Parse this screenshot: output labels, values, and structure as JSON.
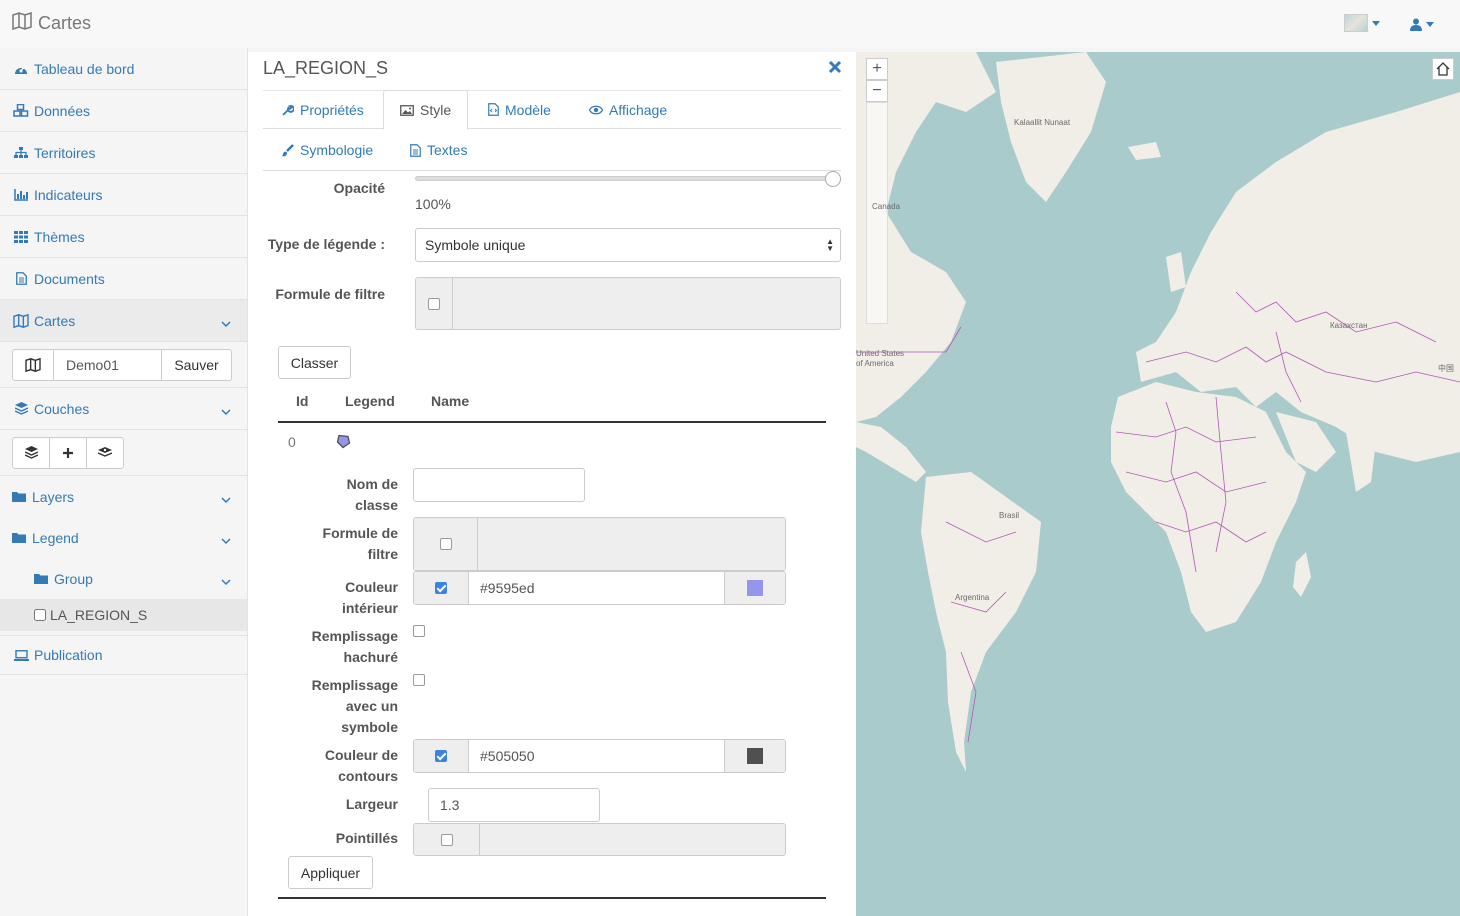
{
  "app": {
    "title": "Cartes"
  },
  "sidebar": {
    "items": [
      {
        "label": "Tableau de bord",
        "icon": "dashboard-icon"
      },
      {
        "label": "Données",
        "icon": "cubes-icon"
      },
      {
        "label": "Territoires",
        "icon": "sitemap-icon"
      },
      {
        "label": "Indicateurs",
        "icon": "bar-chart-icon"
      },
      {
        "label": "Thèmes",
        "icon": "grid-icon"
      },
      {
        "label": "Documents",
        "icon": "document-icon"
      },
      {
        "label": "Cartes",
        "icon": "map-icon"
      }
    ],
    "map_name": "Demo01",
    "save_label": "Sauver",
    "couches_label": "Couches",
    "layers_label": "Layers",
    "legend_label": "Legend",
    "group_label": "Group",
    "layer_item": "LA_REGION_S",
    "publication_label": "Publication"
  },
  "panel": {
    "title": "LA_REGION_S",
    "tabs": [
      "Propriétés",
      "Style",
      "Modèle",
      "Affichage"
    ],
    "active_tab": "Style",
    "subtabs": [
      "Symbologie",
      "Textes"
    ],
    "opacity_label": "Opacité",
    "opacity_value": "100%",
    "opacity_fraction": 1.0,
    "legend_type_label": "Type de légende :",
    "legend_type_value": "Symbole unique",
    "filter_label": "Formule de filtre",
    "classer_label": "Classer",
    "table_headers": [
      "Id",
      "Legend",
      "Name"
    ],
    "row_id": "0",
    "class_name_label_1": "Nom de",
    "class_name_label_2": "classe",
    "class_filter_label_1": "Formule de",
    "class_filter_label_2": "filtre",
    "fill_color_label_1": "Couleur",
    "fill_color_label_2": "intérieur",
    "fill_color_value": "#9595ed",
    "hatch_label_1": "Remplissage",
    "hatch_label_2": "hachuré",
    "symbol_fill_label_1": "Remplissage",
    "symbol_fill_label_2": "avec un",
    "symbol_fill_label_3": "symbole",
    "stroke_color_label_1": "Couleur de",
    "stroke_color_label_2": "contours",
    "stroke_color_value": "#505050",
    "width_label": "Largeur",
    "width_value": "1.3",
    "dash_label": "Pointillés",
    "apply_label": "Appliquer"
  },
  "map": {
    "labels": [
      "Kalaallit Nunaat",
      "Canada",
      "United States",
      "of America",
      "Казахстан",
      "中国",
      "Brasil",
      "Argentina"
    ],
    "ocean_color": "#aacbcb",
    "land_color": "#f1eee8",
    "border_color": "#b05ab5"
  },
  "colors": {
    "accent": "#337ab7"
  }
}
